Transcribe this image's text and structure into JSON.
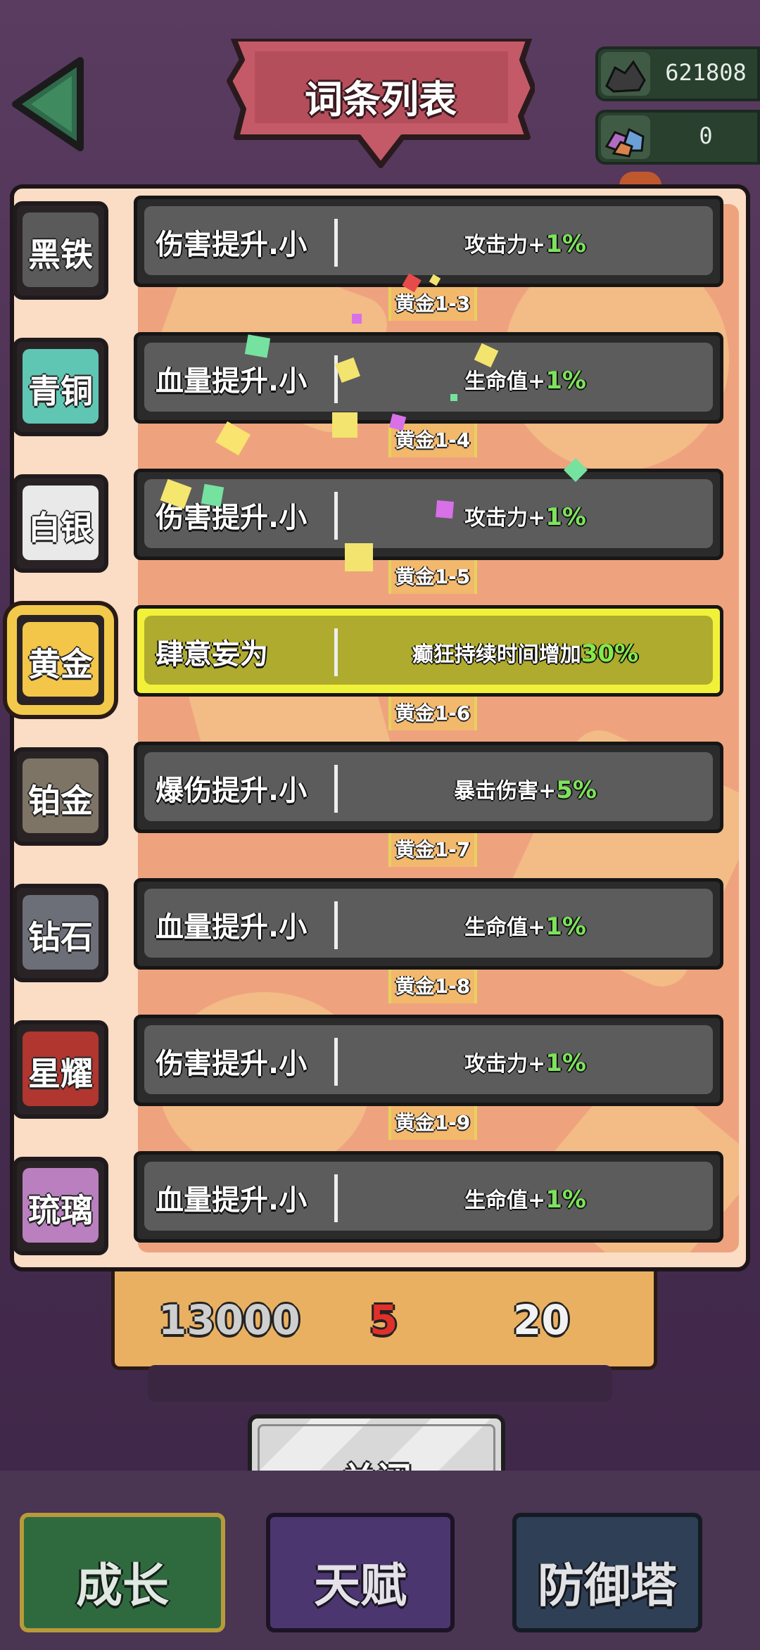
{
  "title": "词条列表",
  "resources": [
    {
      "icon": "coal-ore-icon",
      "value": "621808"
    },
    {
      "icon": "crystal-ore-icon",
      "value": "0"
    }
  ],
  "tiers": [
    {
      "label": "黑铁",
      "color": "#5a5a5a",
      "selected": false
    },
    {
      "label": "青铜",
      "color": "#5fc6b3",
      "selected": false
    },
    {
      "label": "白银",
      "color": "#e9e9e9",
      "selected": false
    },
    {
      "label": "黄金",
      "color": "#f3c64a",
      "selected": true
    },
    {
      "label": "铂金",
      "color": "#7d7466",
      "selected": false
    },
    {
      "label": "钻石",
      "color": "#6d6f78",
      "selected": false
    },
    {
      "label": "星耀",
      "color": "#b0362f",
      "selected": false
    },
    {
      "label": "琉璃",
      "color": "#b97fbf",
      "selected": false
    }
  ],
  "rows": [
    {
      "name": "伤害提升.小",
      "effect": "攻击力+",
      "percent": "1%",
      "highlight": false
    },
    {
      "name": "血量提升.小",
      "effect": "生命值+",
      "percent": "1%",
      "highlight": false
    },
    {
      "name": "伤害提升.小",
      "effect": "攻击力+",
      "percent": "1%",
      "highlight": false
    },
    {
      "name": "肆意妄为",
      "effect": "癫狂持续时间增加",
      "percent": "30%",
      "highlight": true
    },
    {
      "name": "爆伤提升.小",
      "effect": "暴击伤害+",
      "percent": "5%",
      "highlight": false
    },
    {
      "name": "血量提升.小",
      "effect": "生命值+",
      "percent": "1%",
      "highlight": false
    },
    {
      "name": "伤害提升.小",
      "effect": "攻击力+",
      "percent": "1%",
      "highlight": false
    },
    {
      "name": "血量提升.小",
      "effect": "生命值+",
      "percent": "1%",
      "highlight": false
    }
  ],
  "connectors": [
    "黄金1-3",
    "黄金1-4",
    "黄金1-5",
    "黄金1-6",
    "黄金1-7",
    "黄金1-8",
    "黄金1-9"
  ],
  "costs": [
    {
      "value": "13000",
      "color": "#cfcfcf"
    },
    {
      "value": "5",
      "color": "#e0302a"
    },
    {
      "value": "20",
      "color": "#f2f2f2"
    }
  ],
  "close_label": "关闭",
  "nav": [
    {
      "label": "成长",
      "active": true
    },
    {
      "label": "天赋",
      "active": false
    },
    {
      "label": "防御塔",
      "active": false
    }
  ]
}
